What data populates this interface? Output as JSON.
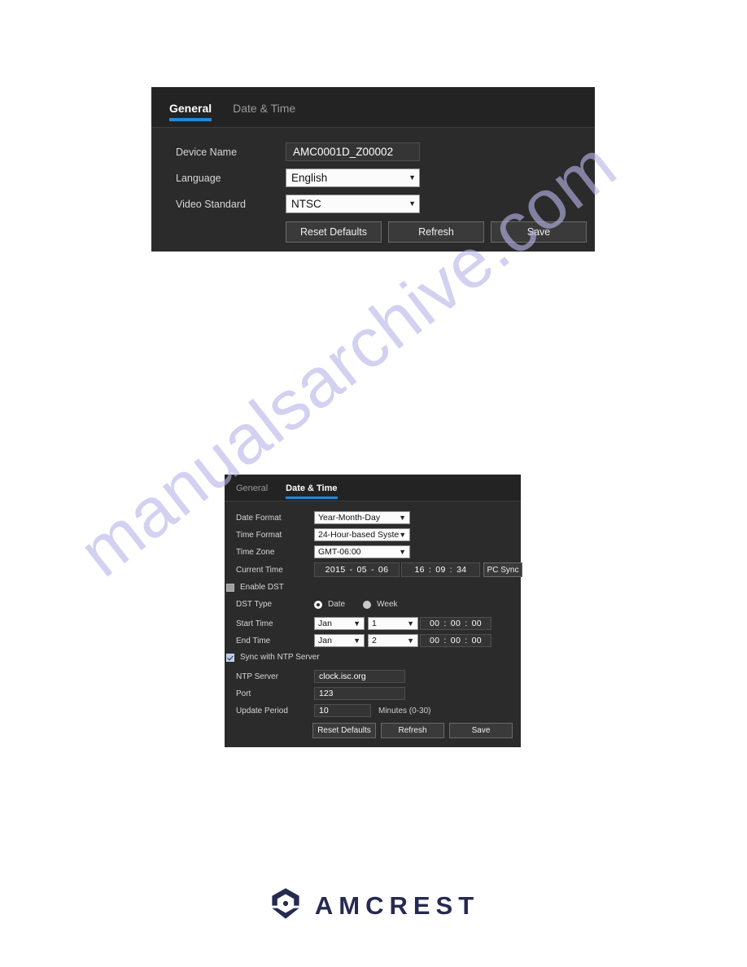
{
  "watermark": {
    "text": "manualsarchive.com",
    "color": "#b9b6ea"
  },
  "theme": {
    "panel_bg": "#2b2b2b",
    "tabbar_bg": "#232323",
    "accent": "#2388d8",
    "label_color": "#d6d6d6",
    "brand_color": "#262a52"
  },
  "panel_general": {
    "tabs": [
      {
        "label": "General",
        "active": true
      },
      {
        "label": "Date & Time",
        "active": false
      }
    ],
    "fields": {
      "device_name_label": "Device Name",
      "device_name_value": "AMC0001D_Z00002",
      "language_label": "Language",
      "language_value": "English",
      "video_standard_label": "Video Standard",
      "video_standard_value": "NTSC"
    },
    "buttons": {
      "reset": "Reset Defaults",
      "refresh": "Refresh",
      "save": "Save"
    }
  },
  "panel_datetime": {
    "tabs": [
      {
        "label": "General",
        "active": false
      },
      {
        "label": "Date & Time",
        "active": true
      }
    ],
    "fields": {
      "date_format_label": "Date Format",
      "date_format_value": "Year-Month-Day",
      "time_format_label": "Time Format",
      "time_format_value": "24-Hour-based Syste",
      "time_zone_label": "Time Zone",
      "time_zone_value": "GMT-06:00",
      "current_time_label": "Current Time",
      "current_date_year": "2015",
      "current_date_month": "05",
      "current_date_day": "06",
      "current_time_hour": "16",
      "current_time_minute": "09",
      "current_time_second": "34",
      "pc_sync_label": "PC Sync",
      "enable_dst_label": "Enable DST",
      "enable_dst_checked": false,
      "dst_type_label": "DST Type",
      "dst_type_date_label": "Date",
      "dst_type_week_label": "Week",
      "dst_type_selected": "Date",
      "start_time_label": "Start Time",
      "start_month": "Jan",
      "start_day": "1",
      "start_hh": "00",
      "start_mm": "00",
      "start_ss": "00",
      "end_time_label": "End Time",
      "end_month": "Jan",
      "end_day": "2",
      "end_hh": "00",
      "end_mm": "00",
      "end_ss": "00",
      "ntp_sync_label": "Sync with NTP Server",
      "ntp_sync_checked": true,
      "ntp_server_label": "NTP Server",
      "ntp_server_value": "clock.isc.org",
      "port_label": "Port",
      "port_value": "123",
      "update_period_label": "Update Period",
      "update_period_value": "10",
      "update_period_hint": "Minutes (0-30)"
    },
    "buttons": {
      "reset": "Reset Defaults",
      "refresh": "Refresh",
      "save": "Save"
    }
  },
  "brand": {
    "name": "AMCREST",
    "logo_icon": "amcrest-hexagon-logo"
  },
  "separators": {
    "colon": ":",
    "dash": "-"
  }
}
